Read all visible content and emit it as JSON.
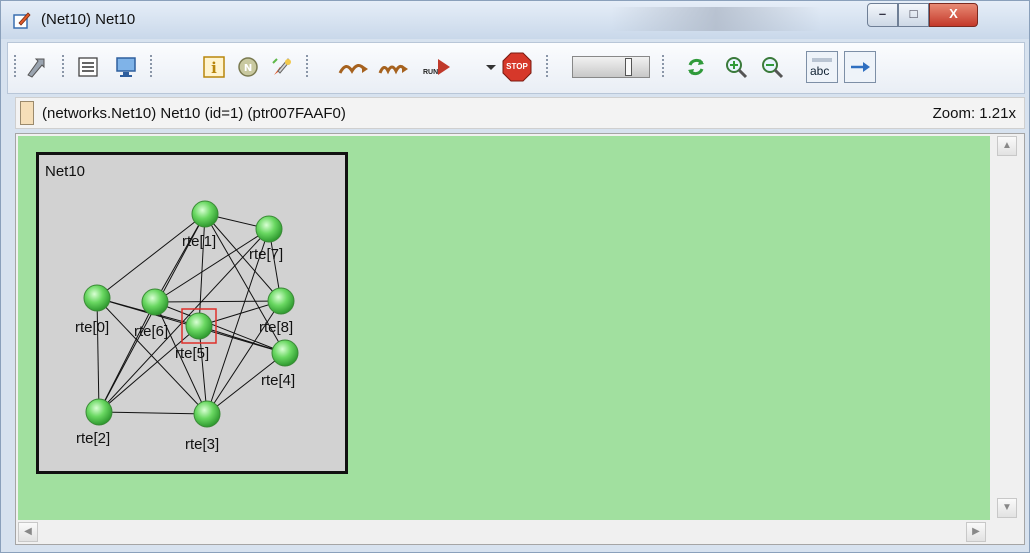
{
  "window": {
    "title": "(Net10) Net10",
    "controls": {
      "minimize": "–",
      "maximize": "□",
      "close": "X"
    }
  },
  "toolbar": {
    "items": [
      "go-up-icon",
      "list-icon",
      "monitor-icon",
      "info-icon",
      "network-icon",
      "rocket-icon",
      "step-icon",
      "fast-icon",
      "run-icon",
      "dropdown-icon",
      "stop-icon",
      "speed-slider",
      "refresh-icon",
      "zoom-in-icon",
      "zoom-out-icon",
      "labels-toggle",
      "arrow-toggle"
    ],
    "run_label": "RUN",
    "stop_label": "STOP",
    "labels_toggle": "abc"
  },
  "infobar": {
    "path": "(networks.Net10) Net10  (id=1)  (ptr007FAAF0)",
    "zoom": "Zoom: 1.21x"
  },
  "network": {
    "title": "Net10",
    "nodes": [
      {
        "id": "rte[0]",
        "label": "rte[0]"
      },
      {
        "id": "rte[1]",
        "label": "rte[1]"
      },
      {
        "id": "rte[2]",
        "label": "rte[2]"
      },
      {
        "id": "rte[3]",
        "label": "rte[3]"
      },
      {
        "id": "rte[4]",
        "label": "rte[4]"
      },
      {
        "id": "rte[5]",
        "label": "rte[5]",
        "selected": true
      },
      {
        "id": "rte[6]",
        "label": "rte[6]"
      },
      {
        "id": "rte[7]",
        "label": "rte[7]"
      },
      {
        "id": "rte[8]",
        "label": "rte[8]"
      }
    ],
    "edges": [
      [
        "rte[0]",
        "rte[1]"
      ],
      [
        "rte[0]",
        "rte[2]"
      ],
      [
        "rte[0]",
        "rte[3]"
      ],
      [
        "rte[0]",
        "rte[4]"
      ],
      [
        "rte[0]",
        "rte[5]"
      ],
      [
        "rte[1]",
        "rte[7]"
      ],
      [
        "rte[1]",
        "rte[6]"
      ],
      [
        "rte[1]",
        "rte[2]"
      ],
      [
        "rte[1]",
        "rte[4]"
      ],
      [
        "rte[1]",
        "rte[8]"
      ],
      [
        "rte[1]",
        "rte[5]"
      ],
      [
        "rte[7]",
        "rte[6]"
      ],
      [
        "rte[7]",
        "rte[3]"
      ],
      [
        "rte[7]",
        "rte[8]"
      ],
      [
        "rte[7]",
        "rte[2]"
      ],
      [
        "rte[6]",
        "rte[8]"
      ],
      [
        "rte[6]",
        "rte[2]"
      ],
      [
        "rte[6]",
        "rte[3]"
      ],
      [
        "rte[6]",
        "rte[4]"
      ],
      [
        "rte[5]",
        "rte[8]"
      ],
      [
        "rte[5]",
        "rte[4]"
      ],
      [
        "rte[5]",
        "rte[2]"
      ],
      [
        "rte[5]",
        "rte[3]"
      ],
      [
        "rte[2]",
        "rte[3]"
      ],
      [
        "rte[3]",
        "rte[4]"
      ],
      [
        "rte[8]",
        "rte[3]"
      ]
    ],
    "colors": {
      "canvas": "#a1e09f",
      "module": "#d2d2d2",
      "node": "#5fd35a",
      "selection": "#e0302a"
    }
  }
}
